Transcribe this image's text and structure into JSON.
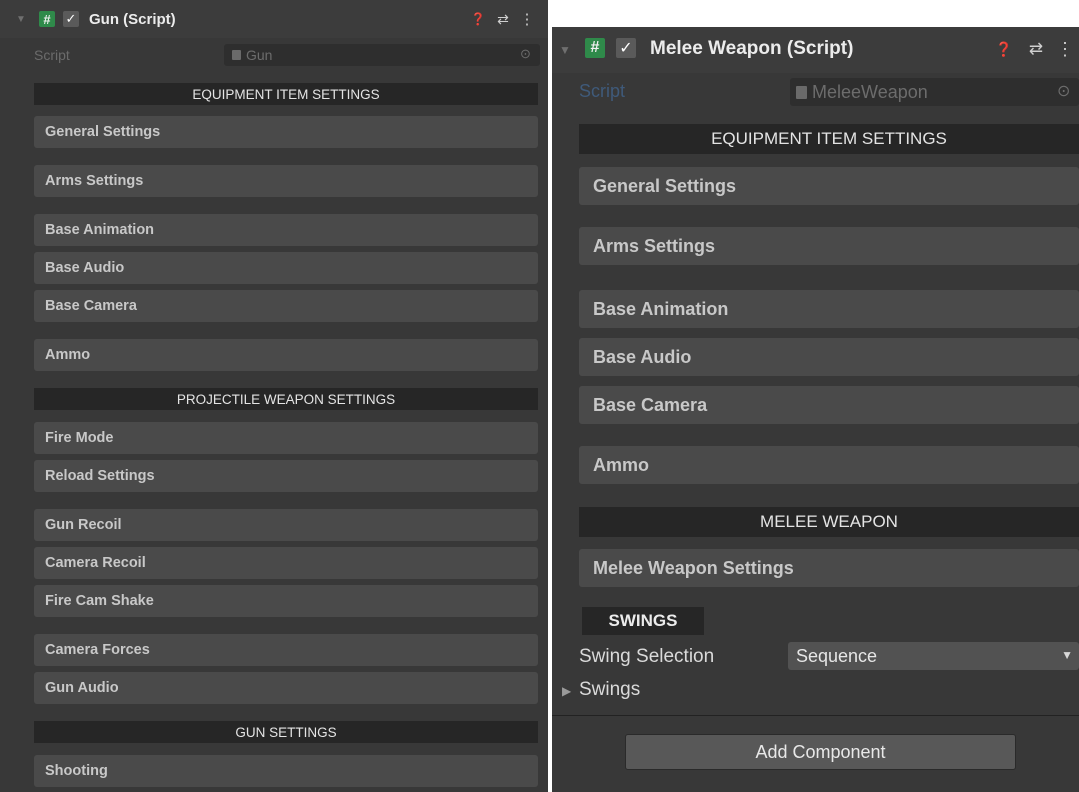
{
  "left": {
    "header": {
      "fold_glyph": "▼",
      "hash_glyph": "#",
      "check_glyph": "✓",
      "title": "Gun (Script)",
      "help_glyph": "❓",
      "preset_glyph": "⇄",
      "menu_glyph": "⋮"
    },
    "script_label": "Script",
    "script_value": "Gun",
    "target_glyph": "⊙",
    "sections": [
      "EQUIPMENT ITEM SETTINGS",
      "PROJECTILE WEAPON SETTINGS",
      "GUN SETTINGS"
    ],
    "buttons": [
      "General Settings",
      "Arms Settings",
      "Base Animation",
      "Base Audio",
      "Base Camera",
      "Ammo",
      "Fire Mode",
      "Reload Settings",
      "Gun Recoil",
      "Camera Recoil",
      "Fire Cam Shake",
      "Camera Forces",
      "Gun Audio",
      "Shooting"
    ]
  },
  "right": {
    "header": {
      "fold_glyph": "▼",
      "hash_glyph": "#",
      "check_glyph": "✓",
      "title": "Melee Weapon (Script)",
      "help_glyph": "❓",
      "preset_glyph": "⇄",
      "menu_glyph": "⋮"
    },
    "script_label": "Script",
    "script_value": "MeleeWeapon",
    "target_glyph": "⊙",
    "sections": [
      "EQUIPMENT ITEM SETTINGS",
      "MELEE WEAPON"
    ],
    "buttons": [
      "General Settings",
      "Arms Settings",
      "Base Animation",
      "Base Audio",
      "Base Camera",
      "Ammo",
      "Melee Weapon Settings"
    ],
    "swings_header": "SWINGS",
    "swing_selection_label": "Swing Selection",
    "swing_selection_value": "Sequence",
    "dropdown_caret": "▼",
    "swings_foldout_glyph": "▶",
    "swings_label": "Swings",
    "add_component": "Add Component"
  }
}
